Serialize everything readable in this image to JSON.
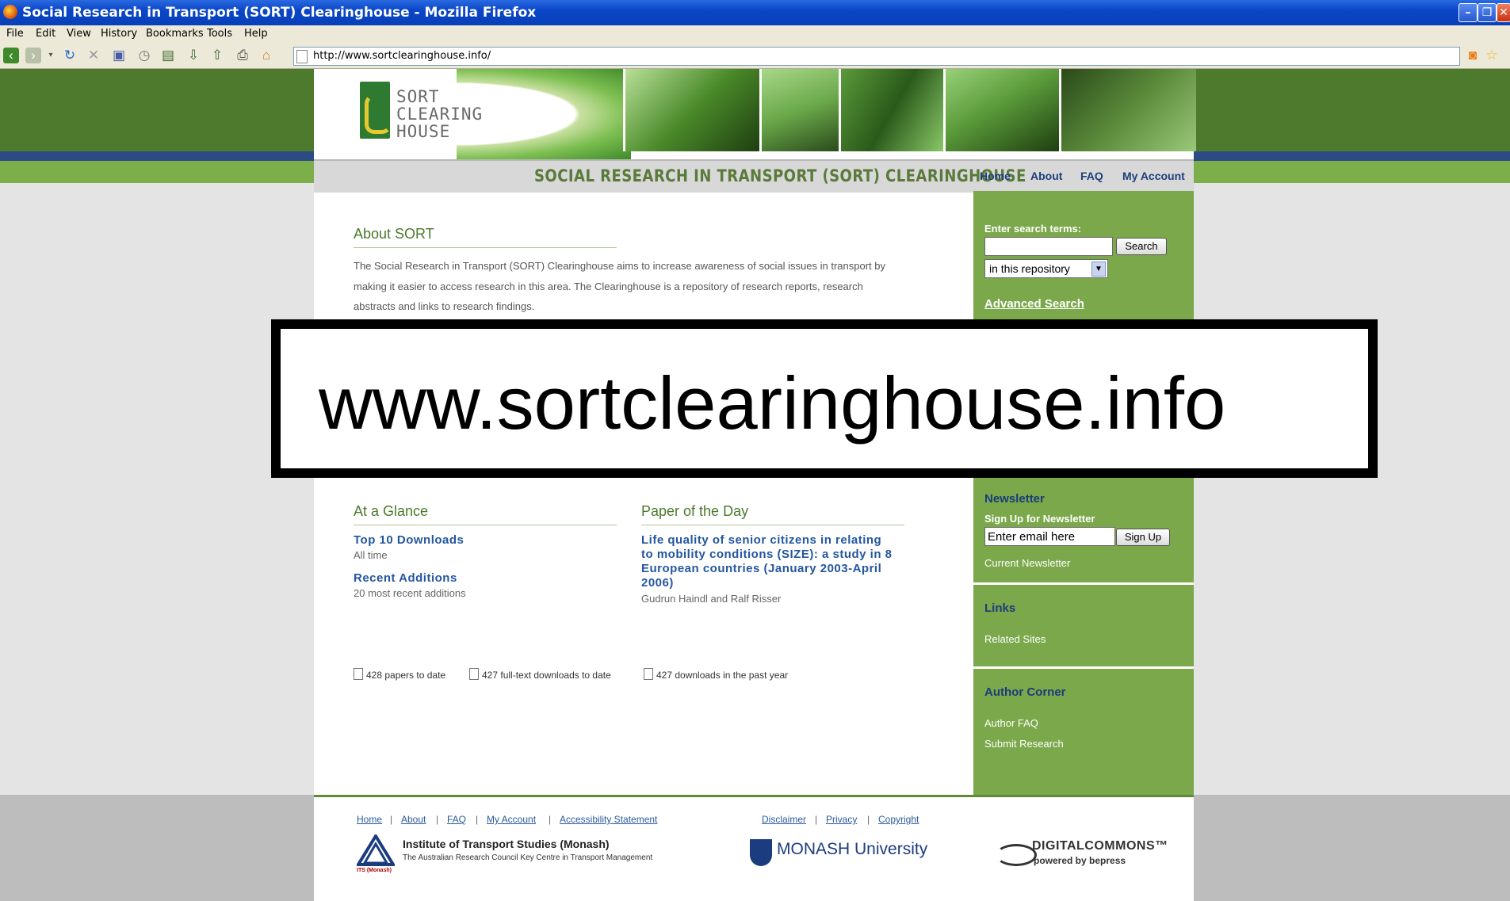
{
  "browser": {
    "window_title": "Social Research in Transport (SORT) Clearinghouse - Mozilla Firefox",
    "menu": [
      "File",
      "Edit",
      "View",
      "History",
      "Bookmarks",
      "Tools",
      "Help"
    ],
    "url": "http://www.sortclearinghouse.info/",
    "toolbar_icons": [
      "back-icon",
      "forward-icon",
      "reload-icon",
      "stop-icon",
      "bookmark-icon",
      "history-icon",
      "new-tab-icon",
      "download-icon",
      "upload-icon",
      "print-icon",
      "home-icon"
    ]
  },
  "site": {
    "logo": [
      "SORT",
      "CLEARING",
      "HOUSE"
    ],
    "title": "SOCIAL RESEARCH IN TRANSPORT (SORT) CLEARINGHOUSE",
    "nav": [
      "Home",
      "About",
      "FAQ",
      "My Account"
    ]
  },
  "about": {
    "heading": "About SORT",
    "lines": [
      "The Social Research in Transport (SORT) Clearinghouse aims to increase awareness of social issues in transport by",
      "making it easier to access research in this area. The Clearinghouse is a repository of research reports, research",
      "abstracts and links to research findings."
    ]
  },
  "overlay_text": "www.sortclearinghouse.info",
  "glance": {
    "heading": "At a Glance",
    "top_downloads": "Top 10 Downloads",
    "top_downloads_sub": "All time",
    "recent": "Recent Additions",
    "recent_sub": "20 most recent additions"
  },
  "paper_of_day": {
    "heading": "Paper of the Day",
    "title_lines": [
      "Life quality of senior citizens in relating",
      "to mobility conditions (SIZE): a study in 8",
      "European countries (January 2003-April",
      "2006)"
    ],
    "authors": "Gudrun Haindl and Ralf Risser"
  },
  "stats": [
    "428 papers to date",
    "427 full-text downloads to date",
    "427 downloads in the past year"
  ],
  "sidebar": {
    "search_label": "Enter search terms:",
    "search_value": "",
    "search_button": "Search",
    "scope": "in this repository",
    "advanced": "Advanced Search",
    "newsletter_heading": "Newsletter",
    "newsletter_label": "Sign Up for Newsletter",
    "email_value": "Enter email here",
    "signup_button": "Sign Up",
    "current_newsletter": "Current Newsletter",
    "links_heading": "Links",
    "related_sites": "Related Sites",
    "author_heading": "Author Corner",
    "author_faq": "Author FAQ",
    "submit_research": "Submit Research"
  },
  "footer": {
    "links_left": [
      "Home",
      "About",
      "FAQ",
      "My Account",
      "Accessibility Statement"
    ],
    "links_right": [
      "Disclaimer",
      "Privacy",
      "Copyright"
    ],
    "its_title": "Institute of Transport Studies (Monash)",
    "its_sub": "The Australian Research Council Key Centre in Transport Management",
    "its_caption": "ITS (Monash)",
    "monash": "MONASH University",
    "dc_title": "DIGITALCOMMONS™",
    "dc_sub": "powered by bepress"
  }
}
